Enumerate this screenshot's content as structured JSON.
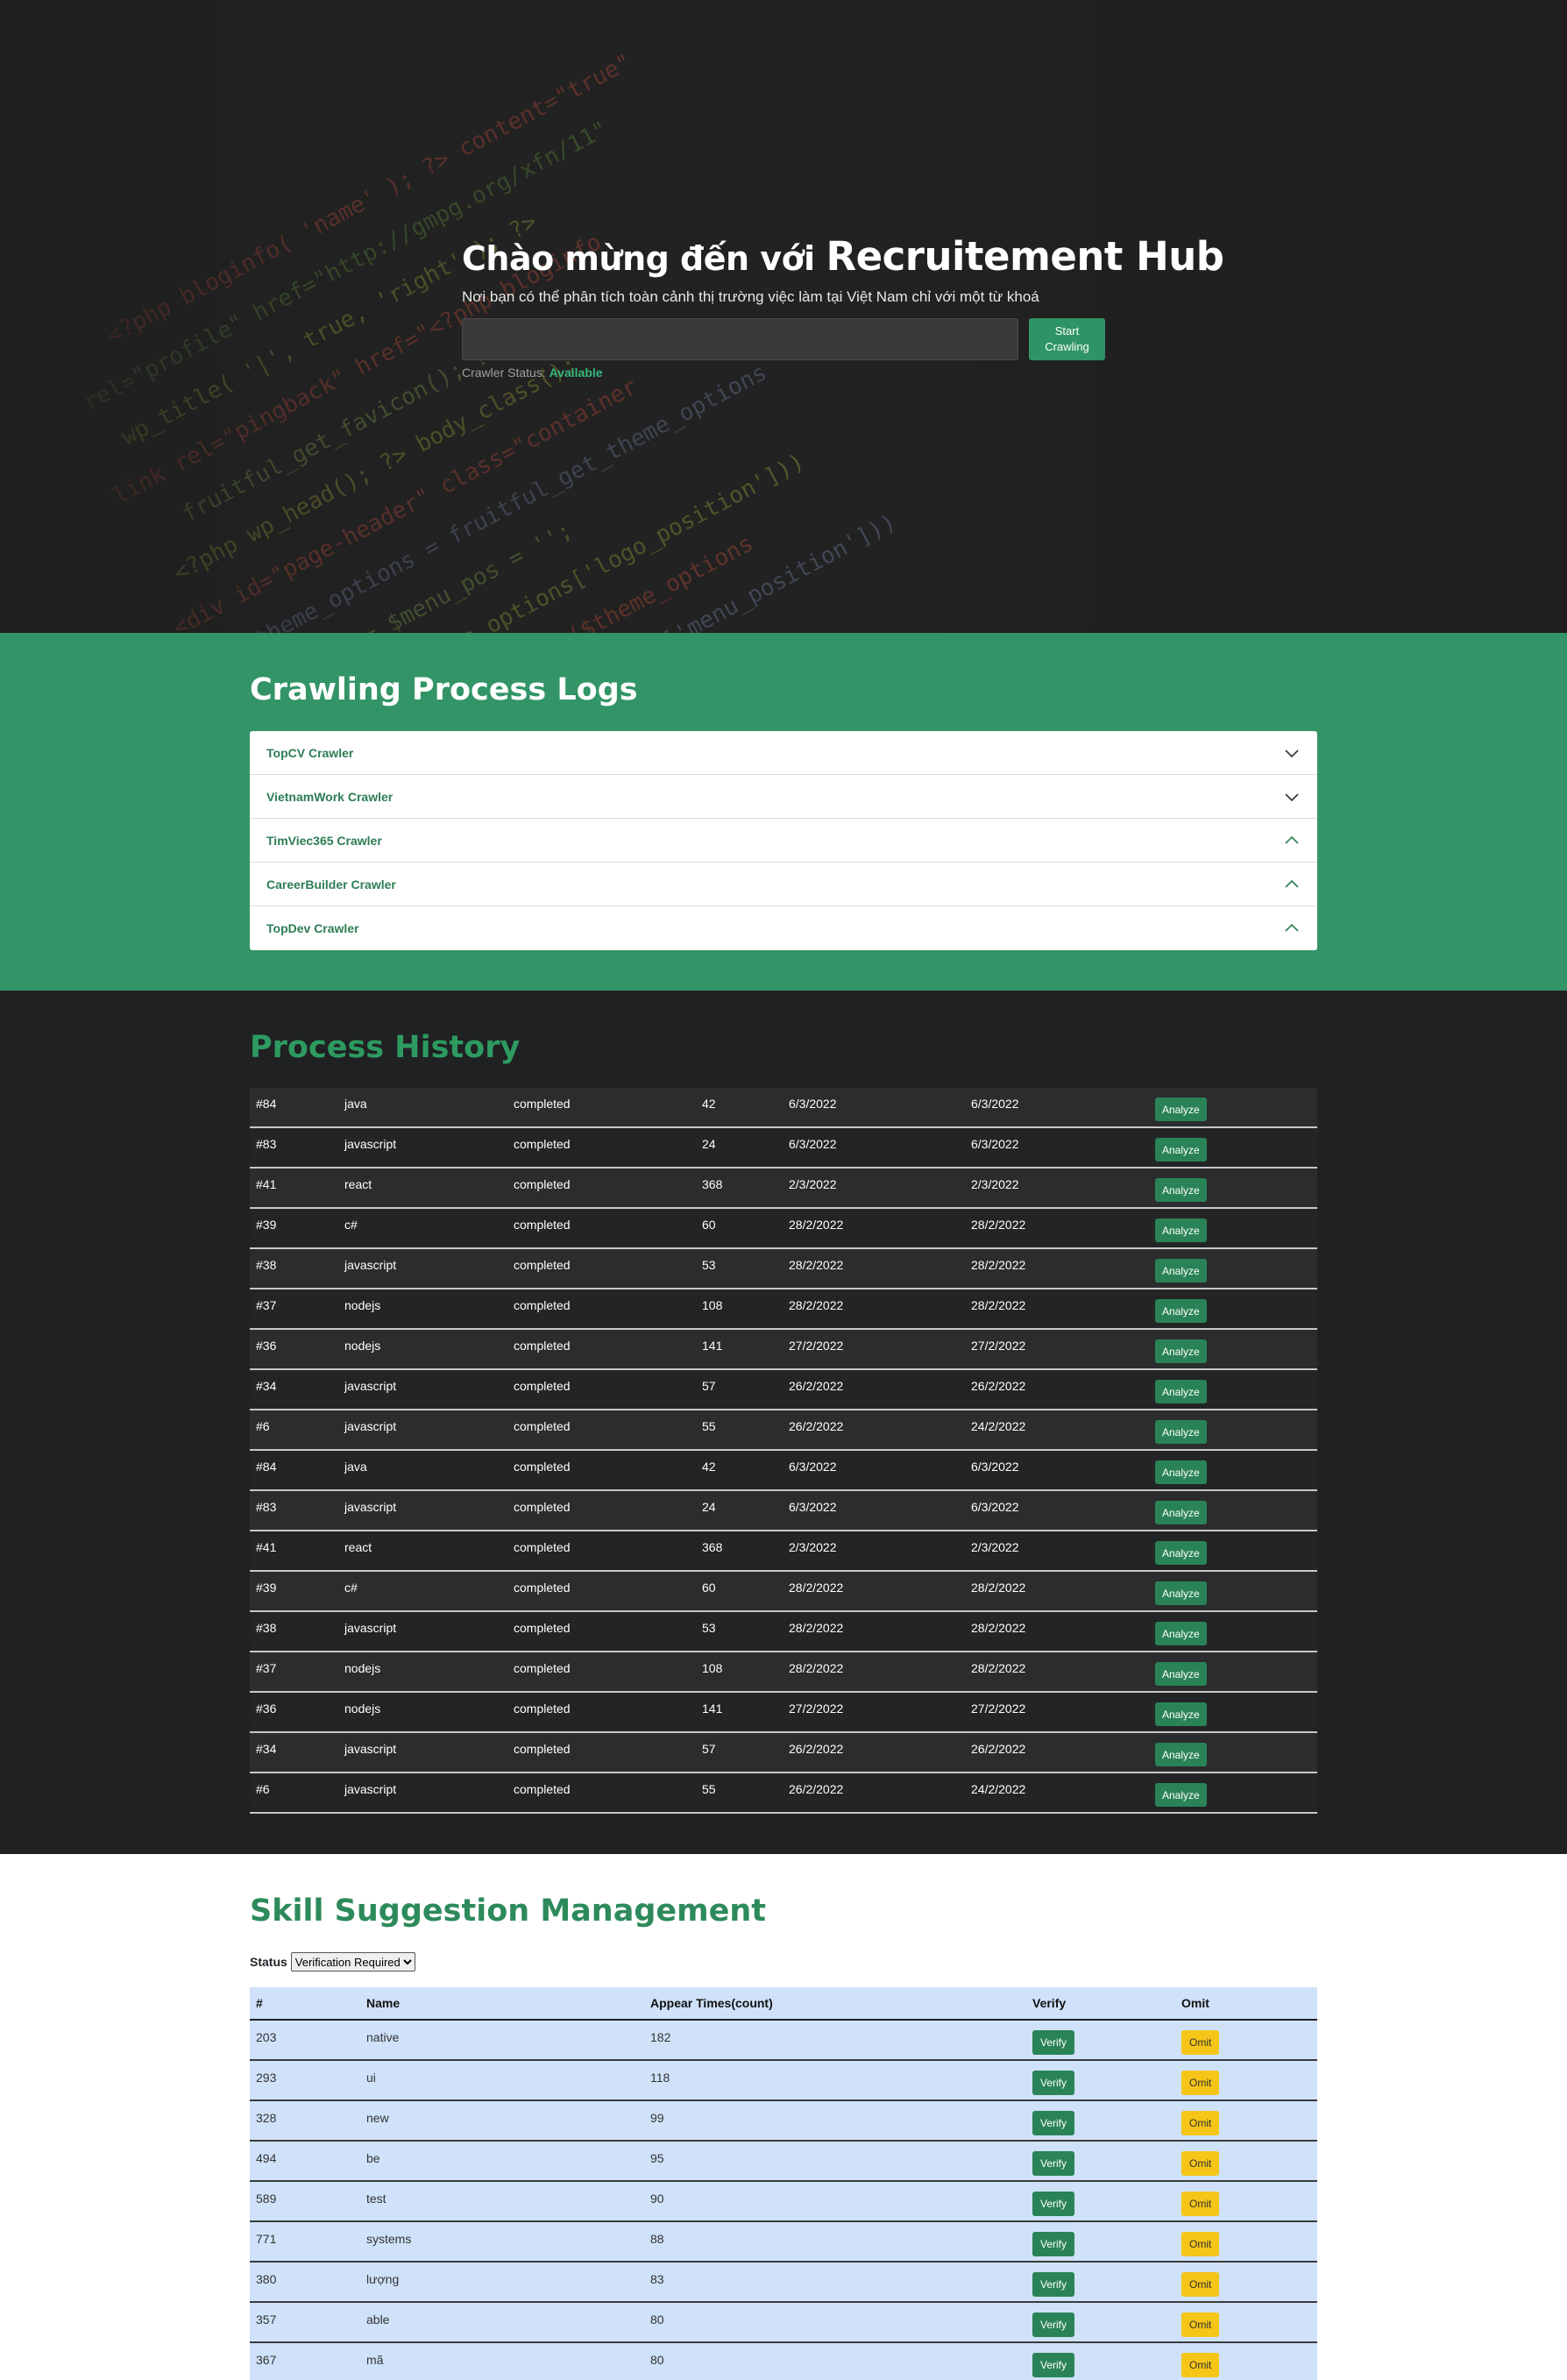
{
  "hero": {
    "title_prefix": "Chào mừng đến với ",
    "title_brand": "Recruitement Hub",
    "subtitle": "Nơi bạn có thể phân tích toàn cảnh thị trường việc làm tại Việt Nam chỉ với một từ khoá",
    "search_value": "",
    "start_label_1": "Start",
    "start_label_2": "Crawling",
    "status_label": "Crawler Status:",
    "status_value": "Available",
    "accent_color": "#2f9465"
  },
  "logs": {
    "title": "Crawling Process Logs",
    "items": [
      {
        "label": "TopCV Crawler",
        "icon": "chevron-down-icon"
      },
      {
        "label": "VietnamWork Crawler",
        "icon": "chevron-down-icon"
      },
      {
        "label": "TimViec365 Crawler",
        "icon": "chevron-up-icon"
      },
      {
        "label": "CareerBuilder Crawler",
        "icon": "chevron-up-icon"
      },
      {
        "label": "TopDev Crawler",
        "icon": "chevron-up-icon"
      }
    ]
  },
  "history": {
    "title": "Process History",
    "button_label": "Analyze",
    "rows": [
      {
        "id": "#84",
        "keyword": "java",
        "status": "completed",
        "count": "42",
        "start": "6/3/2022",
        "end": "6/3/2022"
      },
      {
        "id": "#83",
        "keyword": "javascript",
        "status": "completed",
        "count": "24",
        "start": "6/3/2022",
        "end": "6/3/2022"
      },
      {
        "id": "#41",
        "keyword": "react",
        "status": "completed",
        "count": "368",
        "start": "2/3/2022",
        "end": "2/3/2022"
      },
      {
        "id": "#39",
        "keyword": "c#",
        "status": "completed",
        "count": "60",
        "start": "28/2/2022",
        "end": "28/2/2022"
      },
      {
        "id": "#38",
        "keyword": "javascript",
        "status": "completed",
        "count": "53",
        "start": "28/2/2022",
        "end": "28/2/2022"
      },
      {
        "id": "#37",
        "keyword": "nodejs",
        "status": "completed",
        "count": "108",
        "start": "28/2/2022",
        "end": "28/2/2022"
      },
      {
        "id": "#36",
        "keyword": "nodejs",
        "status": "completed",
        "count": "141",
        "start": "27/2/2022",
        "end": "27/2/2022"
      },
      {
        "id": "#34",
        "keyword": "javascript",
        "status": "completed",
        "count": "57",
        "start": "26/2/2022",
        "end": "26/2/2022"
      },
      {
        "id": "#6",
        "keyword": "javascript",
        "status": "completed",
        "count": "55",
        "start": "26/2/2022",
        "end": "24/2/2022"
      },
      {
        "id": "#84",
        "keyword": "java",
        "status": "completed",
        "count": "42",
        "start": "6/3/2022",
        "end": "6/3/2022"
      },
      {
        "id": "#83",
        "keyword": "javascript",
        "status": "completed",
        "count": "24",
        "start": "6/3/2022",
        "end": "6/3/2022"
      },
      {
        "id": "#41",
        "keyword": "react",
        "status": "completed",
        "count": "368",
        "start": "2/3/2022",
        "end": "2/3/2022"
      },
      {
        "id": "#39",
        "keyword": "c#",
        "status": "completed",
        "count": "60",
        "start": "28/2/2022",
        "end": "28/2/2022"
      },
      {
        "id": "#38",
        "keyword": "javascript",
        "status": "completed",
        "count": "53",
        "start": "28/2/2022",
        "end": "28/2/2022"
      },
      {
        "id": "#37",
        "keyword": "nodejs",
        "status": "completed",
        "count": "108",
        "start": "28/2/2022",
        "end": "28/2/2022"
      },
      {
        "id": "#36",
        "keyword": "nodejs",
        "status": "completed",
        "count": "141",
        "start": "27/2/2022",
        "end": "27/2/2022"
      },
      {
        "id": "#34",
        "keyword": "javascript",
        "status": "completed",
        "count": "57",
        "start": "26/2/2022",
        "end": "26/2/2022"
      },
      {
        "id": "#6",
        "keyword": "javascript",
        "status": "completed",
        "count": "55",
        "start": "26/2/2022",
        "end": "24/2/2022"
      }
    ]
  },
  "skills": {
    "title": "Skill Suggestion Management",
    "filter_label": "Status",
    "filter_selected": "Verification Required",
    "headers": {
      "id": "#",
      "name": "Name",
      "appear": "Appear Times(count)",
      "verify": "Verify",
      "omit": "Omit"
    },
    "verify_label": "Verify",
    "omit_label": "Omit",
    "rows": [
      {
        "id": "203",
        "name": "native",
        "count": "182"
      },
      {
        "id": "293",
        "name": "ui",
        "count": "118"
      },
      {
        "id": "328",
        "name": "new",
        "count": "99"
      },
      {
        "id": "494",
        "name": "be",
        "count": "95"
      },
      {
        "id": "589",
        "name": "test",
        "count": "90"
      },
      {
        "id": "771",
        "name": "systems",
        "count": "88"
      },
      {
        "id": "380",
        "name": "lượng",
        "count": "83"
      },
      {
        "id": "357",
        "name": "able",
        "count": "80"
      },
      {
        "id": "367",
        "name": "mã",
        "count": "80"
      }
    ]
  }
}
